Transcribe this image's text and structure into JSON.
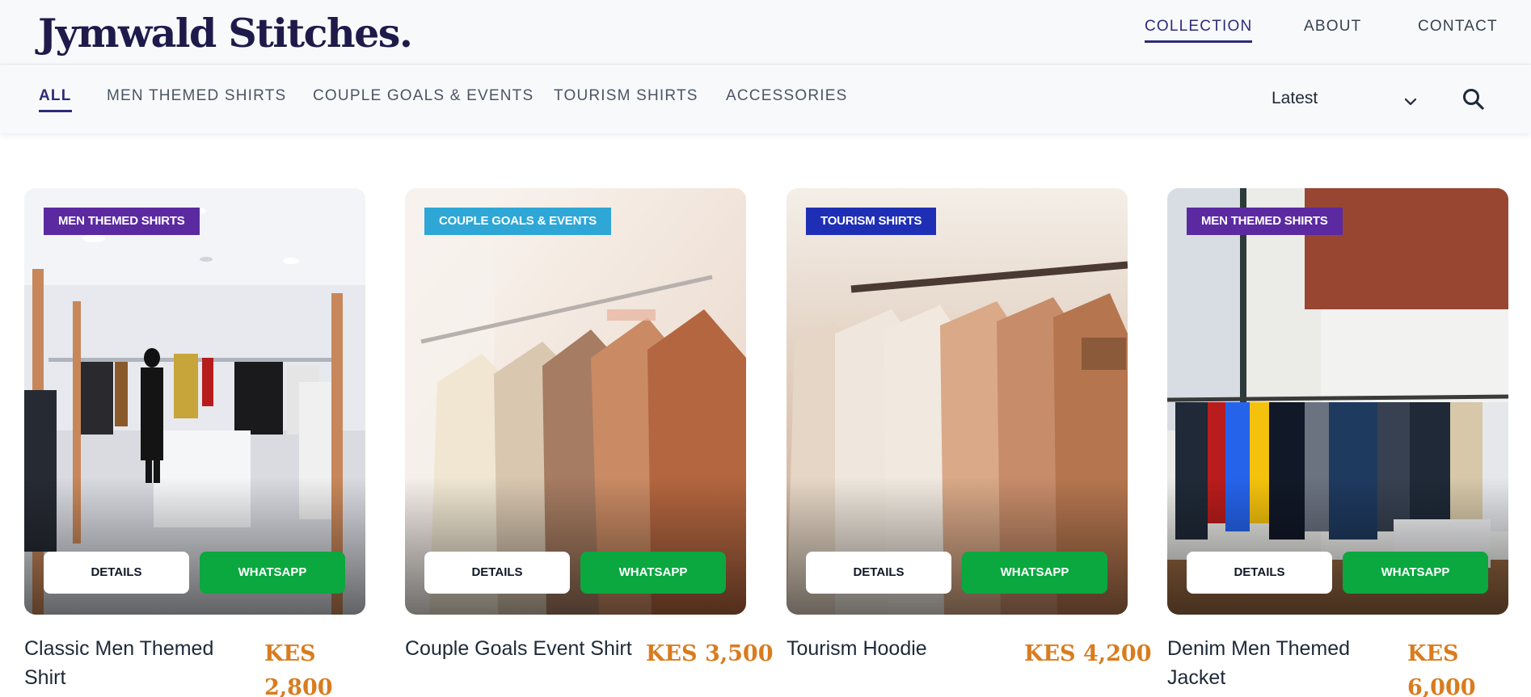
{
  "brand": {
    "name": "Jymwald Stitches."
  },
  "main_nav": [
    {
      "label": "COLLECTION",
      "active": true
    },
    {
      "label": "ABOUT",
      "active": false
    },
    {
      "label": "CONTACT",
      "active": false
    }
  ],
  "categories": [
    {
      "label": "ALL",
      "active": true
    },
    {
      "label": "MEN THEMED SHIRTS",
      "active": false
    },
    {
      "label": "COUPLE GOALS & EVENTS",
      "active": false
    },
    {
      "label": "TOURISM SHIRTS",
      "active": false
    },
    {
      "label": "ACCESSORIES",
      "active": false
    }
  ],
  "sort": {
    "selected": "Latest",
    "icon": "chevron-down-icon"
  },
  "search": {
    "icon": "search-icon"
  },
  "products": [
    {
      "badge": "MEN THEMED SHIRTS",
      "badge_color": "#5b2aa0",
      "name": "Classic Men Themed Shirt",
      "price": "KES 2,800",
      "details_label": "DETAILS",
      "whatsapp_label": "WHATSAPP"
    },
    {
      "badge": "COUPLE GOALS & EVENTS",
      "badge_color": "#2ea7d6",
      "name": "Couple Goals Event Shirt",
      "price": "KES 3,500",
      "details_label": "DETAILS",
      "whatsapp_label": "WHATSAPP"
    },
    {
      "badge": "TOURISM SHIRTS",
      "badge_color": "#1e2fb5",
      "name": "Tourism Hoodie",
      "price": "KES 4,200",
      "details_label": "DETAILS",
      "whatsapp_label": "WHATSAPP"
    },
    {
      "badge": "MEN THEMED SHIRTS",
      "badge_color": "#5b2aa0",
      "name": "Denim Men Themed Jacket",
      "price": "KES 6,000",
      "details_label": "DETAILS",
      "whatsapp_label": "WHATSAPP"
    }
  ],
  "colors": {
    "brand": "#1e1b4b",
    "accent": "#2e2a7a",
    "price": "#d97c1e",
    "whatsapp": "#0aa83f"
  }
}
